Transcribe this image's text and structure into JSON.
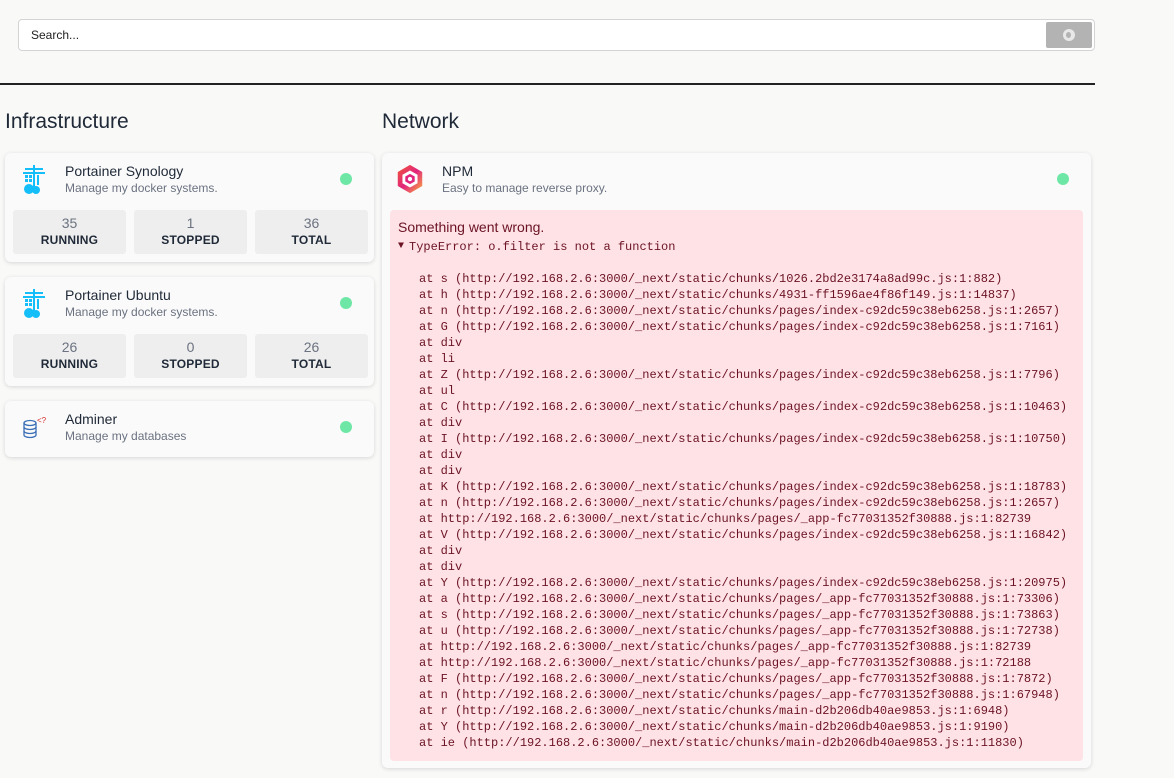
{
  "search": {
    "placeholder": "Search..."
  },
  "sections": {
    "infrastructure": "Infrastructure",
    "network": "Network"
  },
  "colors": {
    "status_ok": "#6ee7a6",
    "error_bg": "#fee2e5",
    "error_text": "#6b1224"
  },
  "infrastructure": [
    {
      "name": "Portainer Synology",
      "description": "Manage my docker systems.",
      "icon": "portainer-icon",
      "stats": [
        {
          "value": "35",
          "label": "RUNNING"
        },
        {
          "value": "1",
          "label": "STOPPED"
        },
        {
          "value": "36",
          "label": "TOTAL"
        }
      ]
    },
    {
      "name": "Portainer Ubuntu",
      "description": "Manage my docker systems.",
      "icon": "portainer-icon",
      "stats": [
        {
          "value": "26",
          "label": "RUNNING"
        },
        {
          "value": "0",
          "label": "STOPPED"
        },
        {
          "value": "26",
          "label": "TOTAL"
        }
      ]
    },
    {
      "name": "Adminer",
      "description": "Manage my databases",
      "icon": "adminer-icon"
    }
  ],
  "network": [
    {
      "name": "NPM",
      "description": "Easy to manage reverse proxy.",
      "icon": "npm-hexagon-icon",
      "error": {
        "title": "Something went wrong.",
        "summary": "TypeError: o.filter is not a function",
        "stack": [
          "at s (http://192.168.2.6:3000/_next/static/chunks/1026.2bd2e3174a8ad99c.js:1:882)",
          "at h (http://192.168.2.6:3000/_next/static/chunks/4931-ff1596ae4f86f149.js:1:14837)",
          "at n (http://192.168.2.6:3000/_next/static/chunks/pages/index-c92dc59c38eb6258.js:1:2657)",
          "at G (http://192.168.2.6:3000/_next/static/chunks/pages/index-c92dc59c38eb6258.js:1:7161)",
          "at div",
          "at li",
          "at Z (http://192.168.2.6:3000/_next/static/chunks/pages/index-c92dc59c38eb6258.js:1:7796)",
          "at ul",
          "at C (http://192.168.2.6:3000/_next/static/chunks/pages/index-c92dc59c38eb6258.js:1:10463)",
          "at div",
          "at I (http://192.168.2.6:3000/_next/static/chunks/pages/index-c92dc59c38eb6258.js:1:10750)",
          "at div",
          "at div",
          "at K (http://192.168.2.6:3000/_next/static/chunks/pages/index-c92dc59c38eb6258.js:1:18783)",
          "at n (http://192.168.2.6:3000/_next/static/chunks/pages/index-c92dc59c38eb6258.js:1:2657)",
          "at http://192.168.2.6:3000/_next/static/chunks/pages/_app-fc77031352f30888.js:1:82739",
          "at V (http://192.168.2.6:3000/_next/static/chunks/pages/index-c92dc59c38eb6258.js:1:16842)",
          "at div",
          "at div",
          "at Y (http://192.168.2.6:3000/_next/static/chunks/pages/index-c92dc59c38eb6258.js:1:20975)",
          "at a (http://192.168.2.6:3000/_next/static/chunks/pages/_app-fc77031352f30888.js:1:73306)",
          "at s (http://192.168.2.6:3000/_next/static/chunks/pages/_app-fc77031352f30888.js:1:73863)",
          "at u (http://192.168.2.6:3000/_next/static/chunks/pages/_app-fc77031352f30888.js:1:72738)",
          "at http://192.168.2.6:3000/_next/static/chunks/pages/_app-fc77031352f30888.js:1:82739",
          "at http://192.168.2.6:3000/_next/static/chunks/pages/_app-fc77031352f30888.js:1:72188",
          "at F (http://192.168.2.6:3000/_next/static/chunks/pages/_app-fc77031352f30888.js:1:7872)",
          "at n (http://192.168.2.6:3000/_next/static/chunks/pages/_app-fc77031352f30888.js:1:67948)",
          "at r (http://192.168.2.6:3000/_next/static/chunks/main-d2b206db40ae9853.js:1:6948)",
          "at Y (http://192.168.2.6:3000/_next/static/chunks/main-d2b206db40ae9853.js:1:9190)",
          "at ie (http://192.168.2.6:3000/_next/static/chunks/main-d2b206db40ae9853.js:1:11830)"
        ]
      }
    }
  ]
}
